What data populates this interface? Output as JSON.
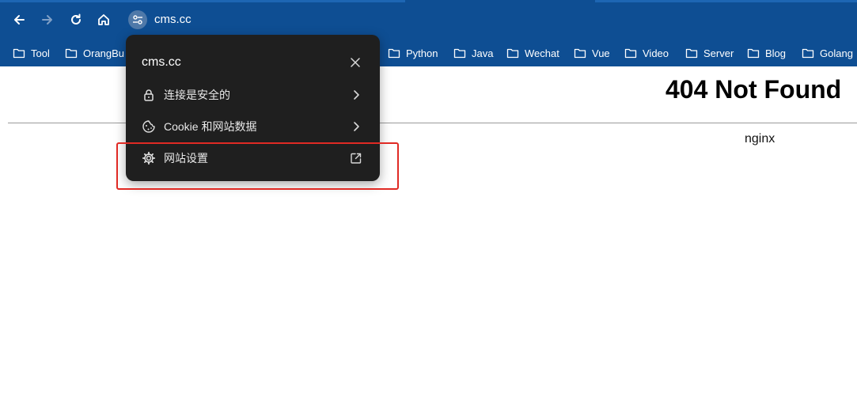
{
  "browser": {
    "url": "cms.cc",
    "theme_color": "#0e4e93",
    "icons": {
      "back": "arrow-left-icon",
      "forward": "arrow-right-icon",
      "reload": "reload-icon",
      "home": "home-icon",
      "site_info": "tune-icon"
    }
  },
  "bookmarks": [
    {
      "label": "Tool",
      "icon": "folder-icon"
    },
    {
      "label": "OrangBu",
      "icon": "folder-icon"
    },
    {
      "label": "Python",
      "icon": "folder-icon"
    },
    {
      "label": "Java",
      "icon": "folder-icon"
    },
    {
      "label": "Wechat",
      "icon": "folder-icon"
    },
    {
      "label": "Vue",
      "icon": "folder-icon"
    },
    {
      "label": "Video",
      "icon": "folder-icon"
    },
    {
      "label": "Server",
      "icon": "folder-icon"
    },
    {
      "label": "Blog",
      "icon": "folder-icon"
    },
    {
      "label": "Golang",
      "icon": "folder-icon"
    }
  ],
  "page": {
    "title": "404 Not Found",
    "server": "nginx"
  },
  "site_popup": {
    "host": "cms.cc",
    "close_icon": "close-icon",
    "items": [
      {
        "label": "连接是安全的",
        "icon": "lock-icon",
        "trailing": "chevron-right-icon"
      },
      {
        "label": "Cookie 和网站数据",
        "icon": "cookie-icon",
        "trailing": "chevron-right-icon"
      },
      {
        "label": "网站设置",
        "icon": "gear-icon",
        "trailing": "open-external-icon"
      }
    ]
  },
  "annotation": {
    "highlight_color": "#e02a24"
  }
}
